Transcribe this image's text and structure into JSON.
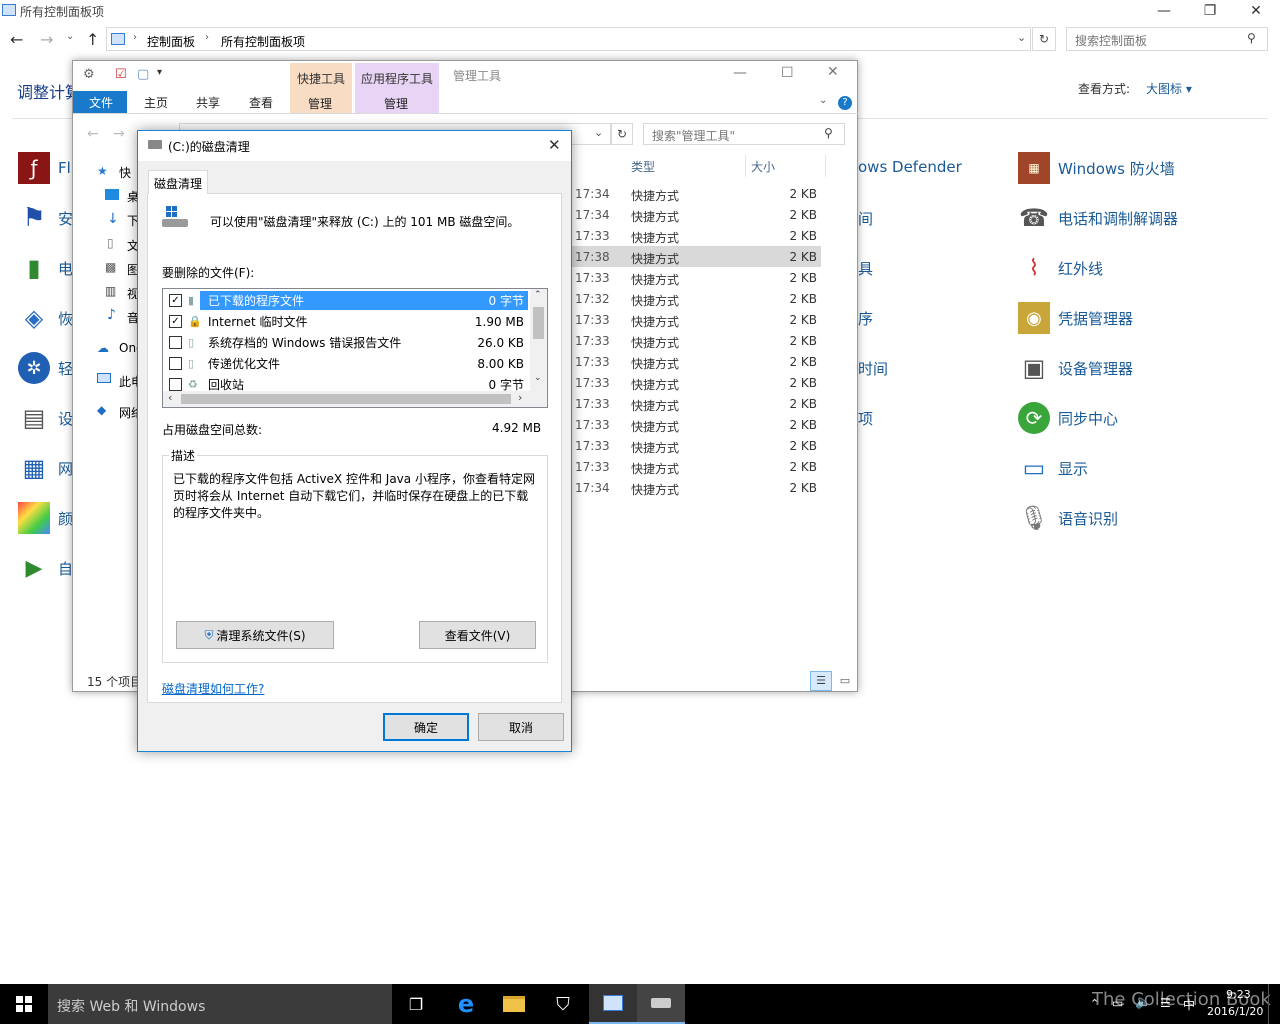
{
  "control_panel": {
    "title": "所有控制面板项",
    "breadcrumb": [
      "控制面板",
      "所有控制面板项"
    ],
    "search_placeholder": "搜索控制面板",
    "heading": "调整计算",
    "view_by_label": "查看方式:",
    "view_by_value": "大图标 ▾",
    "left_items": [
      "Fl",
      "安",
      "电",
      "恢",
      "轻",
      "设",
      "网",
      "颜",
      "自"
    ],
    "mid_items": [
      "ows Defender",
      "间",
      "具",
      "序",
      "时间",
      "项"
    ],
    "right_items": [
      "Windows 防火墙",
      "电话和调制解调器",
      "红外线",
      "凭据管理器",
      "设备管理器",
      "同步中心",
      "显示",
      "语音识别"
    ]
  },
  "explorer": {
    "title": "管理工具",
    "contextual_tabs": [
      {
        "label": "快捷工具",
        "sub": "管理",
        "color": "#f8dcc4"
      },
      {
        "label": "应用程序工具",
        "sub": "管理",
        "color": "#e8d4f4"
      }
    ],
    "ribbon_tabs": [
      "文件",
      "主页",
      "共享",
      "查看"
    ],
    "search_placeholder": "搜索\"管理工具\"",
    "nav_items": [
      "快",
      "桌",
      "下",
      "文",
      "图",
      "视",
      "音",
      "One",
      "此电",
      "网络"
    ],
    "columns": {
      "type": "类型",
      "size": "大小"
    },
    "rows": [
      {
        "time": "17:34",
        "type": "快捷方式",
        "size": "2 KB"
      },
      {
        "time": "17:34",
        "type": "快捷方式",
        "size": "2 KB"
      },
      {
        "time": "17:33",
        "type": "快捷方式",
        "size": "2 KB"
      },
      {
        "time": "17:38",
        "type": "快捷方式",
        "size": "2 KB"
      },
      {
        "time": "17:33",
        "type": "快捷方式",
        "size": "2 KB"
      },
      {
        "time": "17:32",
        "type": "快捷方式",
        "size": "2 KB"
      },
      {
        "time": "17:33",
        "type": "快捷方式",
        "size": "2 KB"
      },
      {
        "time": "17:33",
        "type": "快捷方式",
        "size": "2 KB"
      },
      {
        "time": "17:33",
        "type": "快捷方式",
        "size": "2 KB"
      },
      {
        "time": "17:33",
        "type": "快捷方式",
        "size": "2 KB"
      },
      {
        "time": "17:33",
        "type": "快捷方式",
        "size": "2 KB"
      },
      {
        "time": "17:33",
        "type": "快捷方式",
        "size": "2 KB"
      },
      {
        "time": "17:33",
        "type": "快捷方式",
        "size": "2 KB"
      },
      {
        "time": "17:33",
        "type": "快捷方式",
        "size": "2 KB"
      },
      {
        "time": "17:34",
        "type": "快捷方式",
        "size": "2 KB"
      }
    ],
    "status": "15 个项目"
  },
  "dialog": {
    "title": "(C:)的磁盘清理",
    "tab": "磁盘清理",
    "intro": "可以使用\"磁盘清理\"来释放 (C:) 上的 101 MB 磁盘空间。",
    "files_label": "要删除的文件(F):",
    "files": [
      {
        "name": "已下载的程序文件",
        "size": "0 字节",
        "checked": true,
        "selected": true
      },
      {
        "name": "Internet 临时文件",
        "size": "1.90 MB",
        "checked": true,
        "selected": false
      },
      {
        "name": "系统存档的 Windows 错误报告文件",
        "size": "26.0 KB",
        "checked": false,
        "selected": false
      },
      {
        "name": "传递优化文件",
        "size": "8.00 KB",
        "checked": false,
        "selected": false
      },
      {
        "name": "回收站",
        "size": "0 字节",
        "checked": false,
        "selected": false
      }
    ],
    "total_label": "占用磁盘空间总数:",
    "total_value": "4.92 MB",
    "desc_label": "描述",
    "desc_text": "已下载的程序文件包括 ActiveX 控件和 Java 小程序，你查看特定网页时将会从 Internet 自动下载它们，并临时保存在硬盘上的已下载的程序文件夹中。",
    "clean_system_btn": "清理系统文件(S)",
    "view_files_btn": "查看文件(V)",
    "help_link": "磁盘清理如何工作?",
    "ok": "确定",
    "cancel": "取消"
  },
  "taskbar": {
    "search_placeholder": "搜索 Web 和 Windows",
    "time": "9:23",
    "date": "2016/1/20",
    "ime": "中",
    "watermark": "The Collection Book"
  },
  "colors": {
    "accent": "#1979ca",
    "selection": "#3399ff",
    "link": "#0066cc"
  }
}
